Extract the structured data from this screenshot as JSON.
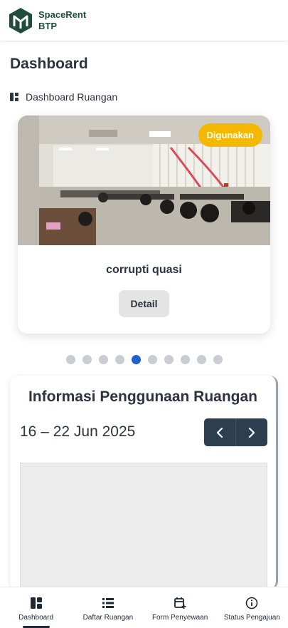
{
  "header": {
    "brand_line1": "SpaceRent",
    "brand_line2": "BTP",
    "logo_icon": "spacerent-logo"
  },
  "page": {
    "title": "Dashboard"
  },
  "breadcrumb": {
    "icon": "dashboard-icon",
    "label": "Dashboard Ruangan"
  },
  "carousel": {
    "active_index": 4,
    "total_slides": 10,
    "card": {
      "status_badge": "Digunakan",
      "room_name": "corrupti quasi",
      "detail_label": "Detail",
      "image": "room-photo"
    }
  },
  "usage": {
    "title": "Informasi Penggunaan Ruangan",
    "date_range": "16 – 22 Jun 2025",
    "prev_icon": "chevron-left-icon",
    "next_icon": "chevron-right-icon"
  },
  "bottom_nav": {
    "items": [
      {
        "label": "Dashboard",
        "icon": "dashboard-icon",
        "active": true
      },
      {
        "label": "Daftar Ruangan",
        "icon": "list-icon",
        "active": false
      },
      {
        "label": "Form Penyewaan",
        "icon": "calendar-plus-icon",
        "active": false
      },
      {
        "label": "Status Pengajuan",
        "icon": "info-icon",
        "active": false
      }
    ]
  },
  "colors": {
    "brand": "#1f4d3a",
    "badge": "#f5b800",
    "active_dot": "#1f5fcf",
    "nav_buttons": "#2c3e50"
  }
}
